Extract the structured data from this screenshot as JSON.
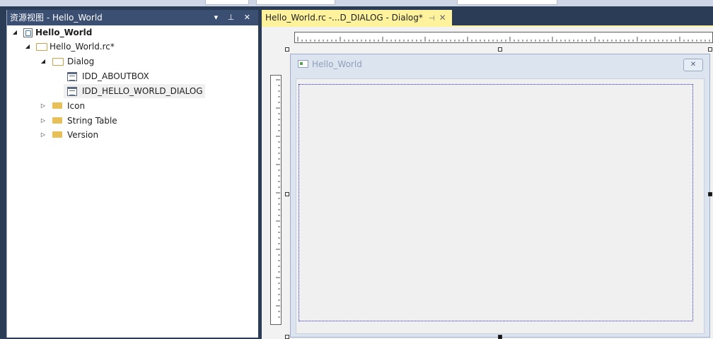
{
  "resource_view": {
    "title": "资源视图 - Hello_World",
    "controls": "▾ ⊥ ✕",
    "tree": [
      {
        "label": "Hello_World",
        "arrow": "◢",
        "icon": "project-icon"
      },
      {
        "label": "Hello_World.rc*",
        "arrow": "◢",
        "icon": "folder-open-icon"
      },
      {
        "label": "Dialog",
        "arrow": "◢",
        "icon": "folder-open-icon"
      },
      {
        "label": "IDD_ABOUTBOX",
        "arrow": "",
        "icon": "dialog-resource-icon"
      },
      {
        "label": "IDD_HELLO_WORLD_DIALOG",
        "arrow": "",
        "icon": "dialog-resource-icon"
      },
      {
        "label": "Icon",
        "arrow": "▷",
        "icon": "folder-icon"
      },
      {
        "label": "String Table",
        "arrow": "▷",
        "icon": "folder-icon"
      },
      {
        "label": "Version",
        "arrow": "▷",
        "icon": "folder-icon"
      }
    ]
  },
  "editor": {
    "tab_label": "Hello_World.rc -...D_DIALOG - Dialog*",
    "tab_pin": "⊣",
    "tab_close": "✕",
    "dialog": {
      "title": "Hello_World",
      "close_glyph": "✕"
    }
  },
  "colors": {
    "chrome": "#2b3c56",
    "panel_title": "#3b4f73",
    "active_tab": "#fff29d",
    "guide": "#2b2bd6"
  }
}
